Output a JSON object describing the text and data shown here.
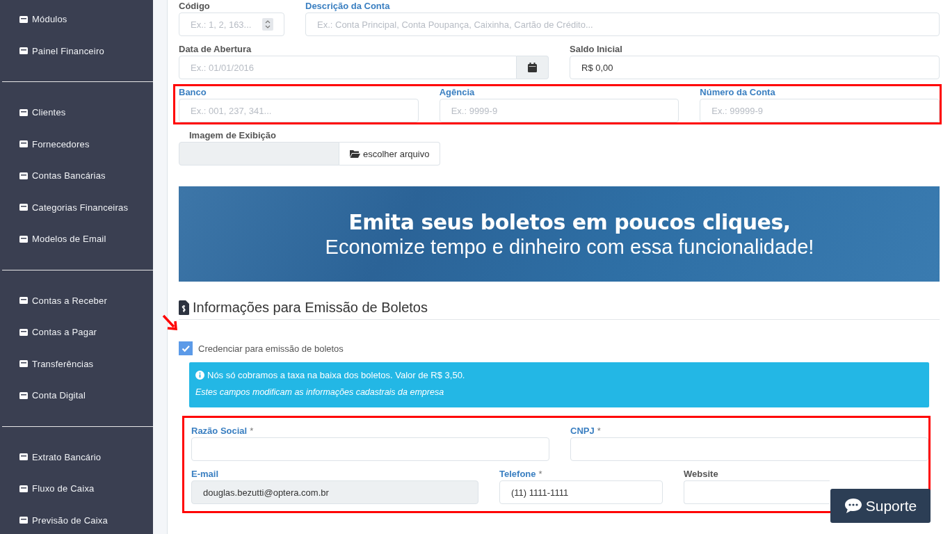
{
  "sidebar": {
    "groups": [
      {
        "items": [
          {
            "label": "Módulos"
          },
          {
            "label": "Painel Financeiro"
          }
        ]
      },
      {
        "items": [
          {
            "label": "Clientes"
          },
          {
            "label": "Fornecedores"
          },
          {
            "label": "Contas Bancárias"
          },
          {
            "label": "Categorias Financeiras"
          },
          {
            "label": "Modelos de Email"
          }
        ]
      },
      {
        "items": [
          {
            "label": "Contas a Receber"
          },
          {
            "label": "Contas a Pagar"
          },
          {
            "label": "Transferências"
          },
          {
            "label": "Conta Digital"
          }
        ]
      },
      {
        "items": [
          {
            "label": "Extrato Bancário"
          },
          {
            "label": "Fluxo de Caixa"
          },
          {
            "label": "Previsão de Caixa"
          }
        ]
      }
    ]
  },
  "account_form": {
    "rows": [
      {
        "annotated": false,
        "fields": [
          {
            "kind": "number",
            "label": "Código",
            "highlighted": false,
            "placeholder": "Ex.: 1, 2, 163..."
          },
          {
            "kind": "text",
            "label": "Descrição da Conta",
            "highlighted": true,
            "placeholder": "Ex.: Conta Principal, Conta Poupança, Caixinha, Cartão de Crédito..."
          }
        ]
      },
      {
        "annotated": false,
        "fields": [
          {
            "kind": "date",
            "label": "Data de Abertura",
            "highlighted": false,
            "placeholder": "Ex.: 01/01/2016"
          },
          {
            "kind": "text",
            "label": "Saldo Inicial",
            "highlighted": false,
            "value": "R$ 0,00"
          }
        ]
      },
      {
        "annotated": true,
        "fields": [
          {
            "kind": "text",
            "label": "Banco",
            "highlighted": true,
            "placeholder": "Ex.: 001, 237, 341..."
          },
          {
            "kind": "text",
            "label": "Agência",
            "highlighted": true,
            "placeholder": "Ex.: 9999-9"
          },
          {
            "kind": "text",
            "label": "Número da Conta",
            "highlighted": true,
            "placeholder": "Ex.: 99999-9"
          }
        ]
      },
      {
        "annotated": false,
        "fields": [
          {
            "kind": "file",
            "label": "Imagem de Exibição",
            "highlighted": false,
            "button": "escolher arquivo"
          }
        ]
      }
    ]
  },
  "banner": {
    "headline": "Emita seus boletos em poucos cliques,",
    "subline": "Economize tempo e dinheiro com essa funcionalidade!"
  },
  "boleto": {
    "title": "Informações para Emissão de Boletos",
    "pointer_arrow": true,
    "checkbox": {
      "label": "Credenciar para emissão de boletos",
      "checked": true
    },
    "alert": {
      "text": "Nós só cobramos a taxa na baixa dos boletos. Valor de R$ 3,50.",
      "note": "Estes campos modificam as informações cadastrais da empresa"
    },
    "company": {
      "annotated": true,
      "rows": [
        {
          "fields": [
            {
              "kind": "text",
              "label": "Razão Social",
              "marker": "*",
              "highlighted": true
            },
            {
              "kind": "text",
              "label": "CNPJ",
              "marker": "*",
              "highlighted": true
            }
          ]
        },
        {
          "fields": [
            {
              "kind": "text",
              "label": "E-mail",
              "highlighted": true,
              "disabled": true,
              "value": "douglas.bezutti@optera.com.br"
            },
            {
              "kind": "text",
              "label": "Telefone",
              "marker": "*",
              "highlighted": true,
              "value": "(11) 1111-1111"
            },
            {
              "kind": "text",
              "label": "Website",
              "highlighted": false
            }
          ]
        }
      ]
    }
  },
  "support_button": {
    "label": "Suporte"
  }
}
